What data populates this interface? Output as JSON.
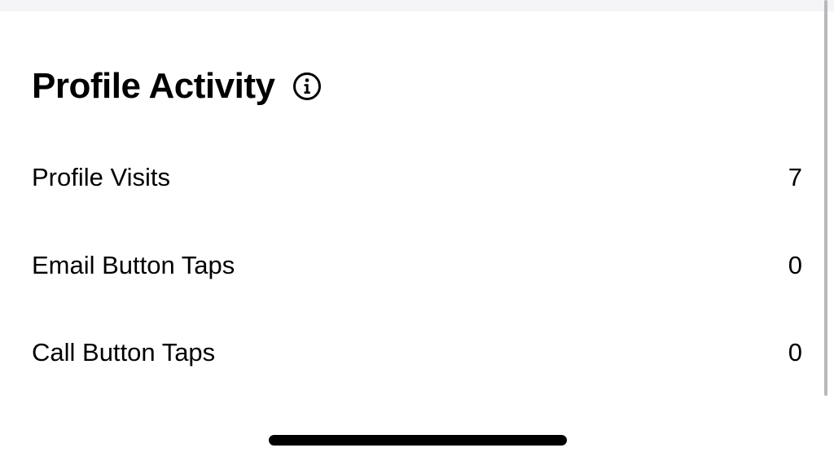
{
  "section": {
    "title": "Profile Activity",
    "info_icon": "info-circle-icon"
  },
  "metrics": [
    {
      "label": "Profile Visits",
      "value": "7"
    },
    {
      "label": "Email Button Taps",
      "value": "0"
    },
    {
      "label": "Call Button Taps",
      "value": "0"
    }
  ],
  "colors": {
    "text": "#000000",
    "background": "#ffffff",
    "top_strip": "#f5f5f7",
    "scrollbar": "#b8b8bc"
  }
}
